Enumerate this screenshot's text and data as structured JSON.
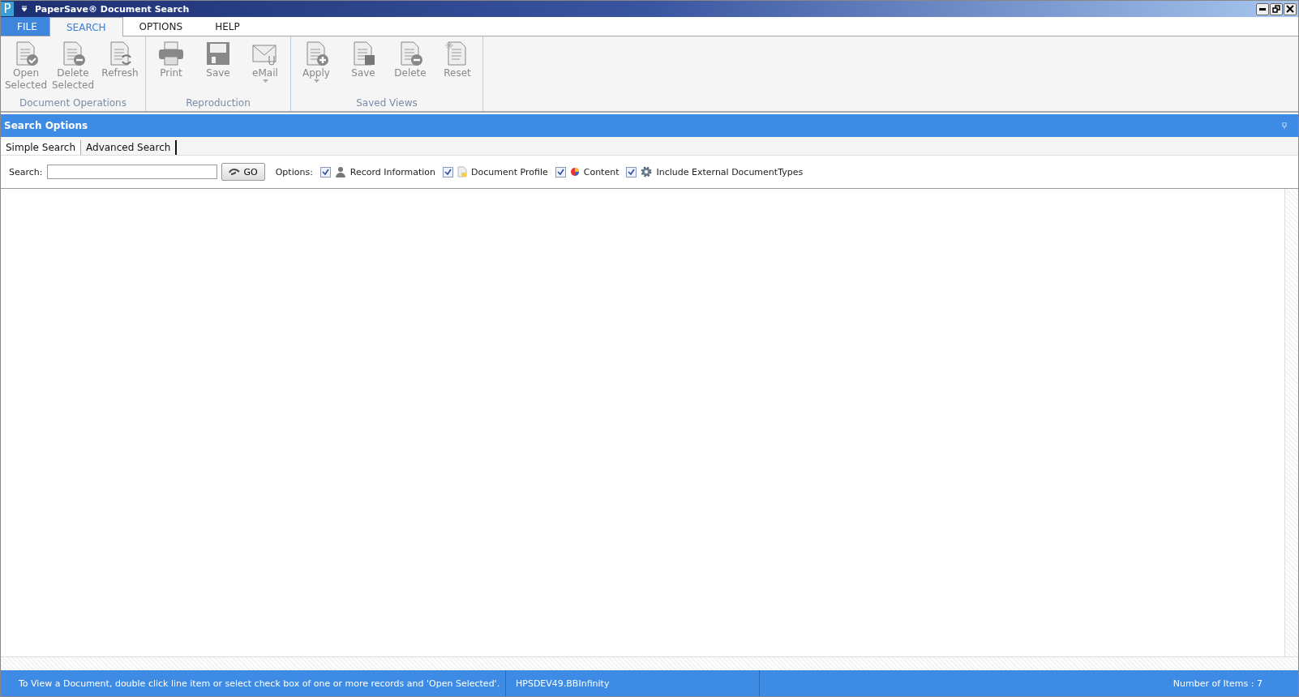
{
  "window": {
    "title": "PaperSave® Document Search",
    "app_letter": "P"
  },
  "menu_tabs": [
    {
      "label": "FILE",
      "kind": "file",
      "selected": false
    },
    {
      "label": "SEARCH",
      "kind": "tab",
      "selected": true
    },
    {
      "label": "OPTIONS",
      "kind": "tab",
      "selected": false
    },
    {
      "label": "HELP",
      "kind": "tab",
      "selected": false
    }
  ],
  "ribbon_groups": [
    {
      "label": "Document Operations",
      "buttons": [
        {
          "label": "Open Selected",
          "kind": "doc-check",
          "dropdown": false
        },
        {
          "label": "Delete Selected",
          "kind": "doc-minus",
          "dropdown": false
        },
        {
          "label": "Refresh",
          "kind": "doc-refresh",
          "dropdown": false
        }
      ]
    },
    {
      "label": "Reproduction",
      "buttons": [
        {
          "label": "Print",
          "kind": "printer",
          "dropdown": false
        },
        {
          "label": "Save",
          "kind": "floppy",
          "dropdown": false
        },
        {
          "label": "eMail",
          "kind": "envelope",
          "dropdown": true
        }
      ]
    },
    {
      "label": "Saved Views",
      "buttons": [
        {
          "label": "Apply",
          "kind": "doc-plus",
          "dropdown": true
        },
        {
          "label": "Save",
          "kind": "doc-floppy",
          "dropdown": false
        },
        {
          "label": "Delete",
          "kind": "doc-minus",
          "dropdown": false
        },
        {
          "label": "Reset",
          "kind": "doc-spark",
          "dropdown": false
        }
      ]
    }
  ],
  "search_panel": {
    "title": "Search Options",
    "tabs": [
      {
        "label": "Simple Search",
        "selected": true
      },
      {
        "label": "Advanced Search",
        "selected": false
      }
    ],
    "search_label": "Search:",
    "go_label": "GO",
    "options_label": "Options:",
    "options": [
      {
        "label": "Record Information",
        "checked": true,
        "kind": "person"
      },
      {
        "label": "Document Profile",
        "checked": true,
        "kind": "doc"
      },
      {
        "label": "Content",
        "checked": true,
        "kind": "pie"
      },
      {
        "label": "Include External DocumentTypes",
        "checked": true,
        "kind": "gear"
      }
    ]
  },
  "status_bar": {
    "hint": "To View a Document, double click line item or select check box of one or more records and 'Open Selected'.",
    "server": "HPSDEV49.BBInfinity",
    "count": "Number of Items : 7"
  }
}
